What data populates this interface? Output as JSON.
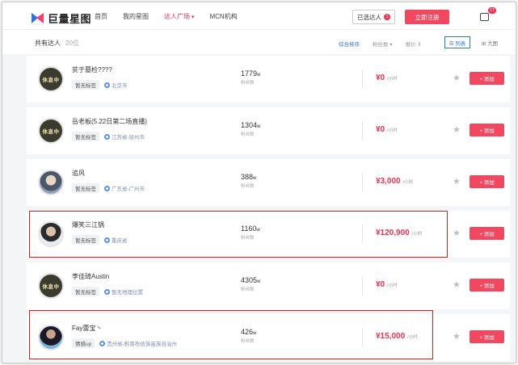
{
  "header": {
    "logo_text": "巨量星图",
    "nav": [
      "首页",
      "我的星图",
      "达人广场",
      "MCN机构"
    ],
    "selected_button": "已选达人",
    "selected_count": "1",
    "register_button": "立即注册",
    "message_badge": "17"
  },
  "list_header": {
    "total_label": "共有达人",
    "total_count": "20位",
    "sorts": [
      "综合排序",
      "粉丝数 ▾",
      "报价 ⇕"
    ],
    "view_list": "☰ 列表",
    "view_grid": "⊞ 大图"
  },
  "rows": [
    {
      "name": "贫于墓检????",
      "tag": "暂无标签",
      "location": "北京市",
      "fans": "1779",
      "fans_unit": "w",
      "fans_label": "粉丝数",
      "price": "¥0",
      "price_unit": "/小时",
      "add": "+ 添加",
      "avatar_text": "休息中"
    },
    {
      "name": "岳老板(5.22日第二场直播)",
      "tag": "暂无标签",
      "location": "江苏省-徐州市",
      "fans": "1304",
      "fans_unit": "w",
      "fans_label": "粉丝数",
      "price": "¥0",
      "price_unit": "/小时",
      "add": "+ 添加",
      "avatar_text": "休息中"
    },
    {
      "name": "追风",
      "tag": "暂无标签",
      "location": "广东省-广州市",
      "fans": "388",
      "fans_unit": "w",
      "fans_label": "粉丝数",
      "price": "¥3,000",
      "price_unit": "/小时",
      "add": "+ 添加",
      "avatar_text": ""
    },
    {
      "name": "爆笑三江锅",
      "tag": "暂无标签",
      "location": "重庆省",
      "fans": "1160",
      "fans_unit": "w",
      "fans_label": "粉丝数",
      "price": "¥120,900",
      "price_unit": "/小时",
      "add": "+ 添加",
      "avatar_text": ""
    },
    {
      "name": "李佳琦Austin",
      "tag": "暂无标签",
      "location": "暂无地理位置",
      "fans": "4305",
      "fans_unit": "w",
      "fans_label": "粉丝数",
      "price": "¥0",
      "price_unit": "/小时",
      "add": "+ 添加",
      "avatar_text": "休息中"
    },
    {
      "name": "Fay蕾宝丶",
      "tag": "情感up",
      "location": "贵州省-黔南布依族苗族自治州",
      "fans": "426",
      "fans_unit": "w",
      "fans_label": "粉丝数",
      "price": "¥15,000",
      "price_unit": "/小时",
      "add": "+ 添加",
      "avatar_text": ""
    }
  ]
}
